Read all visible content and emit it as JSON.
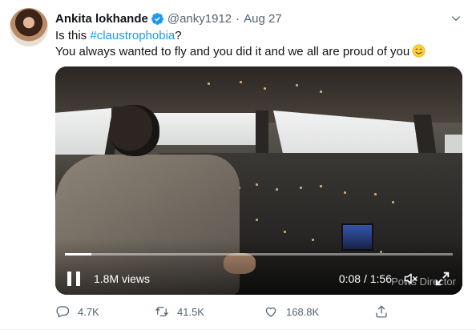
{
  "tweet": {
    "author_name": "Ankita lokhande",
    "handle": "@anky1912",
    "separator": "·",
    "date": "Aug 27",
    "text_line1_prefix": "Is this ",
    "hashtag": "#claustrophobia",
    "text_line1_suffix": "?",
    "text_line2": "You always wanted to fly and you did it and we all are proud of you"
  },
  "video": {
    "views": "1.8M views",
    "current_time": "0:08",
    "time_separator": " / ",
    "duration": "1:56",
    "progress": 0.069,
    "watermark": "Pows Director"
  },
  "actions": {
    "replies": "4.7K",
    "retweets": "41.5K",
    "likes": "168.8K"
  },
  "icons": {
    "verified": "verified-badge-icon",
    "caret": "chevron-down-icon",
    "emoji": "smiling-face-emoji",
    "reply": "reply-icon",
    "retweet": "retweet-icon",
    "like": "heart-icon",
    "share": "share-icon",
    "pause": "pause-icon",
    "mute": "speaker-muted-icon",
    "expand": "fullscreen-icon"
  },
  "colors": {
    "accent": "#1d9bf0",
    "text": "#0f1419",
    "muted": "#536471"
  }
}
